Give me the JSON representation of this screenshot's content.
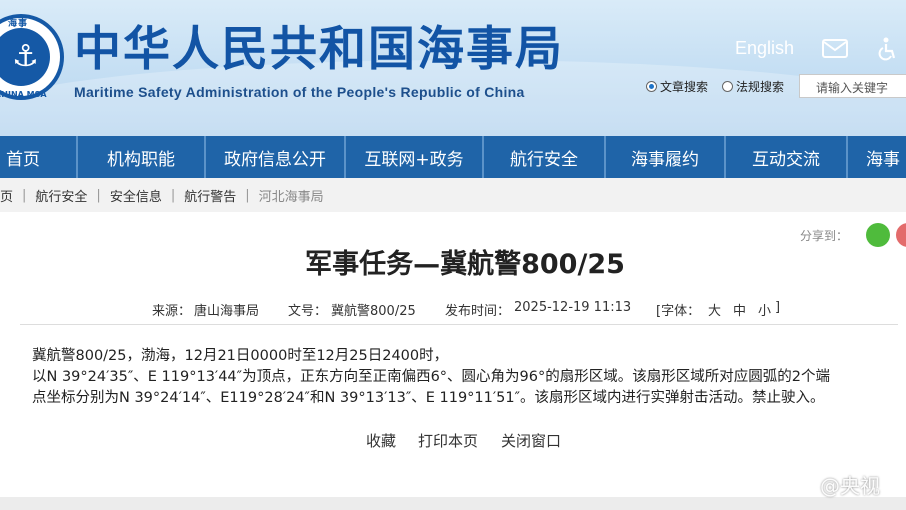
{
  "header": {
    "logo_text_cn": "海事",
    "logo_text_en": "CHINA MSA",
    "title": "中华人民共和国海事局",
    "subtitle": "Maritime Safety Administration of the People's Republic of China",
    "english_link": "English",
    "search": {
      "option_article": "文章搜索",
      "option_law": "法规搜索",
      "placeholder": "请输入关键字",
      "selected": "文章搜索"
    }
  },
  "nav": {
    "items": [
      {
        "label": "首页"
      },
      {
        "label": "机构职能"
      },
      {
        "label": "政府信息公开"
      },
      {
        "label": "互联网+政务"
      },
      {
        "label": "航行安全"
      },
      {
        "label": "海事履约"
      },
      {
        "label": "互动交流"
      },
      {
        "label": "海事"
      }
    ]
  },
  "breadcrumb": {
    "items": [
      "页",
      "航行安全",
      "安全信息",
      "航行警告",
      "河北海事局"
    ]
  },
  "share": {
    "label": "分享到："
  },
  "article": {
    "title": "军事任务—冀航警800/25",
    "source_label": "来源：",
    "source_value": "唐山海事局",
    "docno_label": "文号：",
    "docno_value": "冀航警800/25",
    "date_label": "发布时间：",
    "date_value": "2025-12-19 11:13",
    "font_label": "[字体：",
    "font_large": "大",
    "font_medium": "中",
    "font_small": "小",
    "font_close": "]",
    "paragraph_1": "冀航警800/25，渤海，12月21日0000时至12月25日2400时，",
    "paragraph_2": "以N 39°24′35″、E 119°13′44″为顶点，正东方向至正南偏西6°、圆心角为96°的扇形区域。该扇形区域所对应圆弧的2个端",
    "paragraph_3": "点坐标分别为N 39°24′14″、E119°28′24″和N 39°13′13″、E 119°11′51″。该扇形区域内进行实弹射击活动。禁止驶入。",
    "actions": {
      "favorite": "收藏",
      "print": "打印本页",
      "close": "关闭窗口"
    }
  },
  "watermark": "@央视",
  "colors": {
    "nav_bg": "#1f64a8",
    "title_blue": "#1254a5",
    "header_bg": "#c4def3"
  }
}
